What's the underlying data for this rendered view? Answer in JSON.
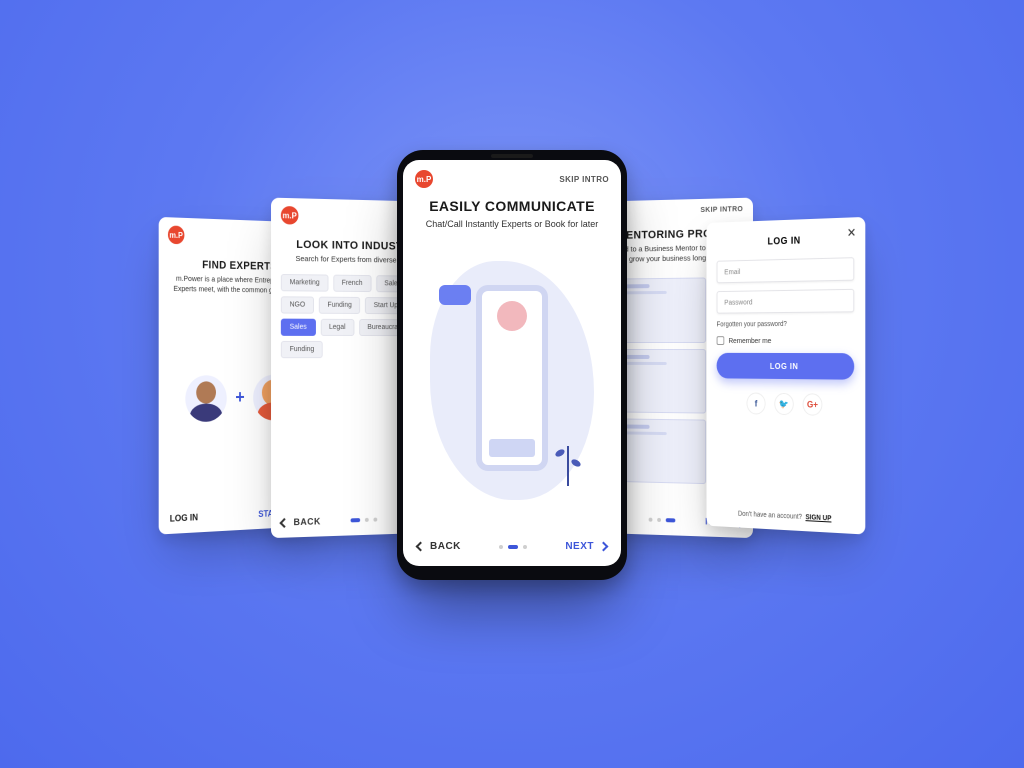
{
  "brand": {
    "logo_text": "m.P"
  },
  "common": {
    "skip_intro": "SKIP INTRO",
    "back": "BACK",
    "next": "NEXT"
  },
  "card1": {
    "title": "FIND EXPERTS",
    "subtitle": "m.Power is a place where Entrepreneurs & Experts meet, with the common goal to grow",
    "login": "LOG IN",
    "start": "START TOUR"
  },
  "card2": {
    "title": "LOOK INTO INDUSTRIES",
    "subtitle": "Search for Experts from diverse Industries",
    "chips": [
      "Marketing",
      "French",
      "Sales",
      "NGO",
      "Funding",
      "Start Ups",
      "Sales",
      "Legal",
      "Bureaucracy",
      "Funding"
    ],
    "active_chip_index": 6
  },
  "card3": {
    "title": "EASILY COMMUNICATE",
    "subtitle": "Chat/Call Instantly Experts or Book for later"
  },
  "card4": {
    "title": "JOIN  A MENTORING PROGRAM",
    "subtitle": "Get matched to a Business Mentor to help you build and grow your business long term."
  },
  "card5": {
    "title": "LOG IN",
    "email_placeholder": "Email",
    "password_placeholder": "Password",
    "forgot": "Forgotten your password?",
    "remember": "Remember me",
    "login_button": "LOG IN",
    "social": {
      "f": "f",
      "t": "🐦",
      "g": "G+"
    },
    "signup_prompt": "Don't have an account?",
    "signup_action": "SIGN UP"
  },
  "colors": {
    "accent": "#5d6ff0",
    "brand": "#e8472f"
  }
}
